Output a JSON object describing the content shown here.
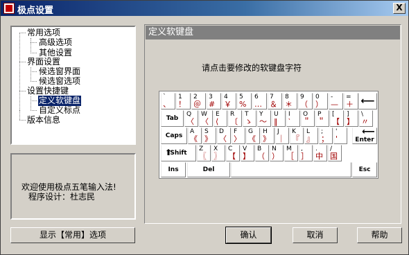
{
  "window": {
    "title": "极点设置",
    "close_label": "X"
  },
  "tree": {
    "items": [
      {
        "label": "常用选项",
        "level": 0
      },
      {
        "label": "高级选项",
        "level": 1
      },
      {
        "label": "其他设置",
        "level": 1
      },
      {
        "label": "界面设置",
        "level": 0
      },
      {
        "label": "候选窗界面",
        "level": 1
      },
      {
        "label": "候选窗选项",
        "level": 1
      },
      {
        "label": "设置快捷键",
        "level": 0
      },
      {
        "label": "定义软键盘",
        "level": 1,
        "selected": true
      },
      {
        "label": "自定义标点",
        "level": 1
      },
      {
        "label": "版本信息",
        "level": 0
      }
    ]
  },
  "welcome": {
    "line1": "欢迎使用极点五笔输入法!",
    "line2": "程序设计：杜志民"
  },
  "buttons": {
    "show_common": "显示【常用】选项",
    "ok": "确认",
    "cancel": "取消",
    "help": "帮助"
  },
  "panel": {
    "header": "定义软键盘",
    "instruction": "请点击要修改的软键盘字符"
  },
  "keyboard": {
    "row1": [
      [
        "`",
        "、"
      ],
      [
        "1",
        "！"
      ],
      [
        "2",
        "＠"
      ],
      [
        "3",
        "#"
      ],
      [
        "4",
        "￥"
      ],
      [
        "5",
        "%"
      ],
      [
        "6",
        "…"
      ],
      [
        "7",
        "＆"
      ],
      [
        "8",
        "＊"
      ],
      [
        "9",
        "（"
      ],
      [
        "0",
        "）"
      ],
      [
        "-",
        "—"
      ],
      [
        "=",
        "＋"
      ]
    ],
    "backspace": "⟵",
    "tab": "Tab",
    "row2": [
      [
        "Q",
        "〈"
      ],
      [
        "W",
        "〈"
      ],
      [
        "E",
        "⟨"
      ],
      [
        "R",
        "〔"
      ],
      [
        "T",
        "ゝ"
      ],
      [
        "Y",
        "〜"
      ],
      [
        "U",
        "‖"
      ],
      [
        "I",
        "‵"
      ],
      [
        "O",
        "＂"
      ],
      [
        "P",
        "＂"
      ],
      [
        "[",
        "【"
      ],
      [
        "]",
        "】"
      ],
      [
        "\\",
        "〃"
      ]
    ],
    "caps": "Caps",
    "row3": [
      [
        "A",
        "《"
      ],
      [
        "S",
        "》"
      ],
      [
        "D",
        "〈"
      ],
      [
        "F",
        "〉"
      ],
      [
        "G",
        "《"
      ],
      [
        "H",
        "》"
      ],
      [
        "J",
        "｜"
      ],
      [
        "K",
        "『"
      ],
      [
        "L",
        "』"
      ],
      [
        ";",
        "；"
      ],
      [
        "'",
        "'"
      ]
    ],
    "enter": "Enter",
    "shift": "Shift",
    "row4": [
      [
        "Z",
        "〖"
      ],
      [
        "X",
        "〗"
      ],
      [
        "C",
        "【"
      ],
      [
        "V",
        "】"
      ],
      [
        "B",
        "（"
      ],
      [
        "N",
        "）"
      ],
      [
        "M",
        "［"
      ],
      [
        ",",
        "］"
      ],
      [
        ".",
        "中"
      ],
      [
        "/",
        "国"
      ]
    ],
    "ins": "Ins",
    "del": "Del",
    "esc": "Esc"
  }
}
